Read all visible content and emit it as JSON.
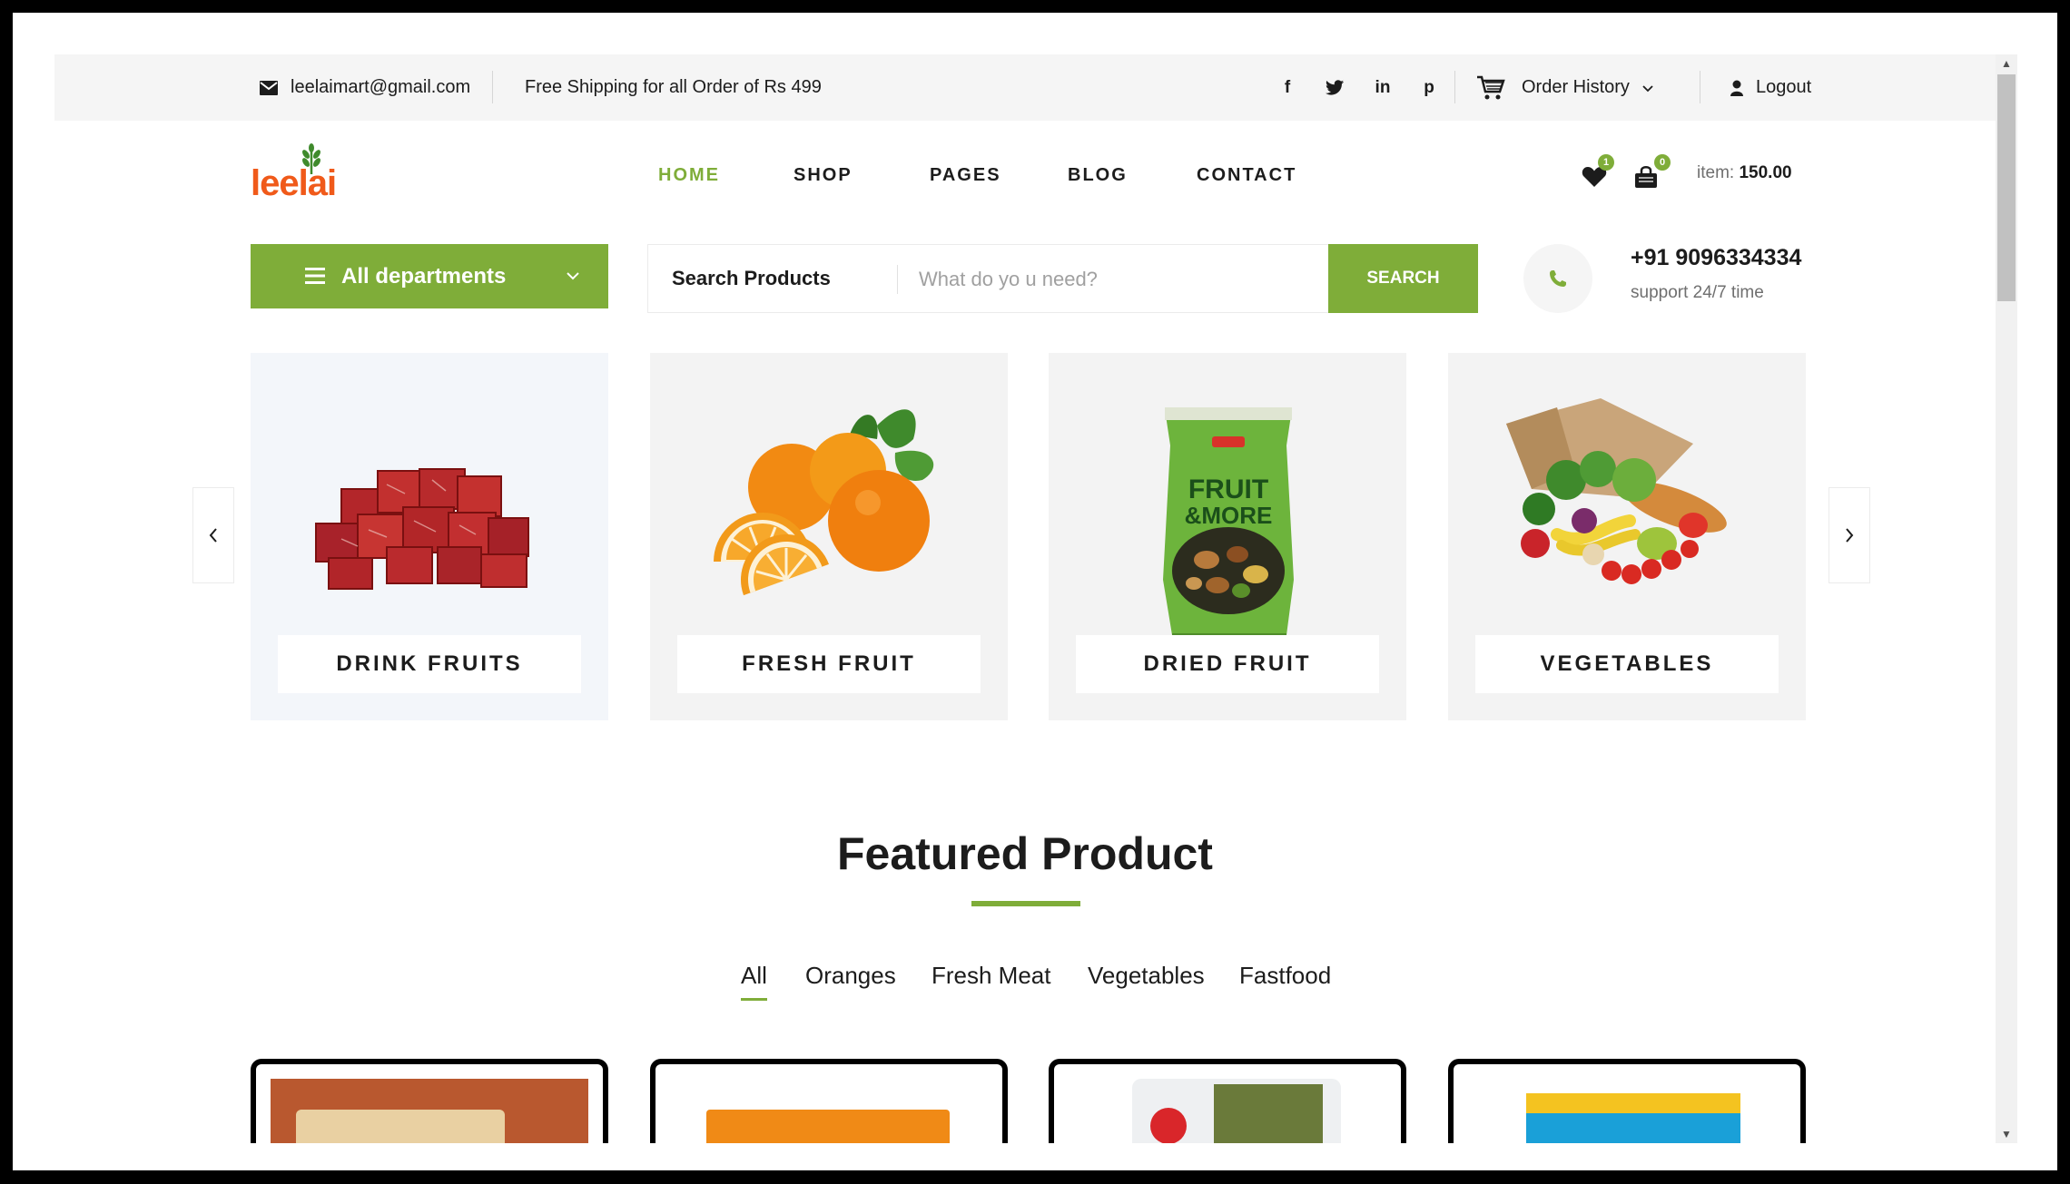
{
  "topbar": {
    "email": "leelaimart@gmail.com",
    "shipping": "Free Shipping for all Order of Rs 499",
    "order_history": "Order History",
    "logout": "Logout",
    "social": [
      "f",
      "t",
      "in",
      "p"
    ]
  },
  "logo": {
    "text": "leelai"
  },
  "nav": {
    "items": [
      {
        "label": "HOME",
        "active": true
      },
      {
        "label": "SHOP"
      },
      {
        "label": "PAGES"
      },
      {
        "label": "BLOG"
      },
      {
        "label": "CONTACT"
      }
    ]
  },
  "header": {
    "wishlist_count": "1",
    "cart_count": "0",
    "cart_label": "item:",
    "cart_total": "150.00"
  },
  "departments": {
    "label": "All departments"
  },
  "search": {
    "category": "Search Products",
    "placeholder": "What do yo u need?",
    "button": "SEARCH"
  },
  "contact": {
    "phone": "+91 9096334334",
    "support": "support 24/7 time"
  },
  "categories": [
    {
      "label": "DRINK FRUITS",
      "icon": "meat-cubes-image"
    },
    {
      "label": "FRESH FRUIT",
      "icon": "oranges-image"
    },
    {
      "label": "DRIED FRUIT",
      "icon": "dried-fruit-pack-image"
    },
    {
      "label": "VEGETABLES",
      "icon": "grocery-bag-image"
    }
  ],
  "featured": {
    "title": "Featured Product",
    "filters": [
      "All",
      "Oranges",
      "Fresh Meat",
      "Vegetables",
      "Fastfood"
    ],
    "active_filter": "All"
  },
  "colors": {
    "accent": "#7fad39",
    "logo": "#f05a1a"
  }
}
